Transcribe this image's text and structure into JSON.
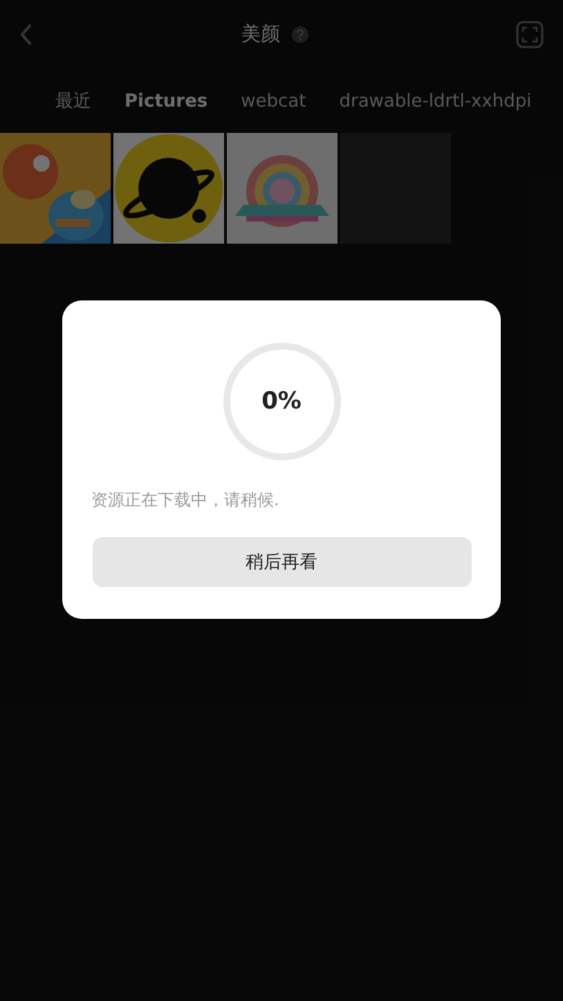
{
  "header": {
    "title": "美颜"
  },
  "tabs": [
    {
      "label": "最近",
      "selected": false
    },
    {
      "label": "Pictures",
      "selected": true
    },
    {
      "label": "webcat",
      "selected": false
    },
    {
      "label": "drawable-ldrtl-xxhdpi",
      "selected": false
    }
  ],
  "thumbnails": [
    {
      "kind": "picture"
    },
    {
      "kind": "picture"
    },
    {
      "kind": "picture"
    },
    {
      "kind": "empty"
    }
  ],
  "dialog": {
    "progress": {
      "reading": "0%"
    },
    "message": "资源正在下载中，请稍候.",
    "button": "稍后再看"
  }
}
